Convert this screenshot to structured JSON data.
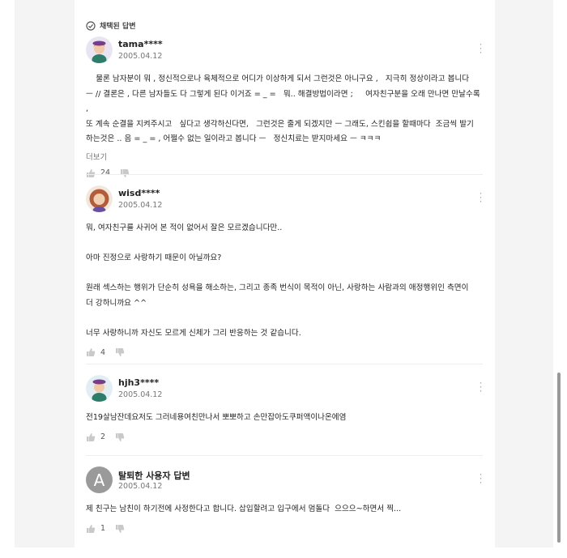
{
  "badge": {
    "label": "채택된 답변"
  },
  "answers": [
    {
      "user": "tama****",
      "date": "2005.04.12",
      "text": "    물론 남자분이 뭐 , 정신적으로나 육체적으로 어디가 이상하게 되서 그런것은 아니구요 ,   지극히 정상이라고 봅니다\nㅡ // 결론은 , 다른 남자들도 다 그렇게 된다 이거죠 = _ =   뭐.. 해결방법이라면 ;     여자친구분을 오래 만나면 만날수록 ,\n또 계속 순결을 지켜주시고   싶다고 생각하신다면,   그런것은 줄게 되겠지만 ㅡ 그래도, 스킨쉽을 할때마다  조금씩 발기\n하는것은 .. 음 = _ = , 어쩔수 없는 일이라고 봅니다 ㅡ   정신치료는 받지마세요 ㅡ ㅋㅋㅋ",
      "more": "더보기",
      "likes": "24"
    },
    {
      "user": "wisd****",
      "date": "2005.04.12",
      "text": "뭐, 여자친구를 사귀어 본 적이 없어서 잘은 모르겠습니다만..\n\n아마 진정으로 사랑하기 때문이 아닐까요?\n\n원래 섹스하는 행위가 단순히 성욕을 해소하는, 그리고 종족 번식이 목적이 아닌, 사랑하는 사람과의 애정행위인 측면이\n더 강하니까요 ^^\n\n너무 사랑하니까 자신도 모르게 신체가 그리 반응하는 것 같습니다.",
      "likes": "4"
    },
    {
      "user": "hjh3****",
      "date": "2005.04.12",
      "text": "전19살남잔데요저도 그러네용여친만나서 뽀뽀하고 손만잡아도쿠퍼액이나온에염",
      "likes": "2"
    },
    {
      "user": "탈퇴한 사용자 답변",
      "date": "2005.04.12",
      "avatar_letter": "A",
      "text": "제 친구는 남친이 하기전에 사정한다고 합니다. 삽입할려고 입구에서 멈돌다  으으으~하면서 찍...",
      "likes": "1"
    }
  ],
  "colors": {
    "gutter": "#f4f4f4",
    "text": "#222222",
    "muted": "#777777"
  }
}
